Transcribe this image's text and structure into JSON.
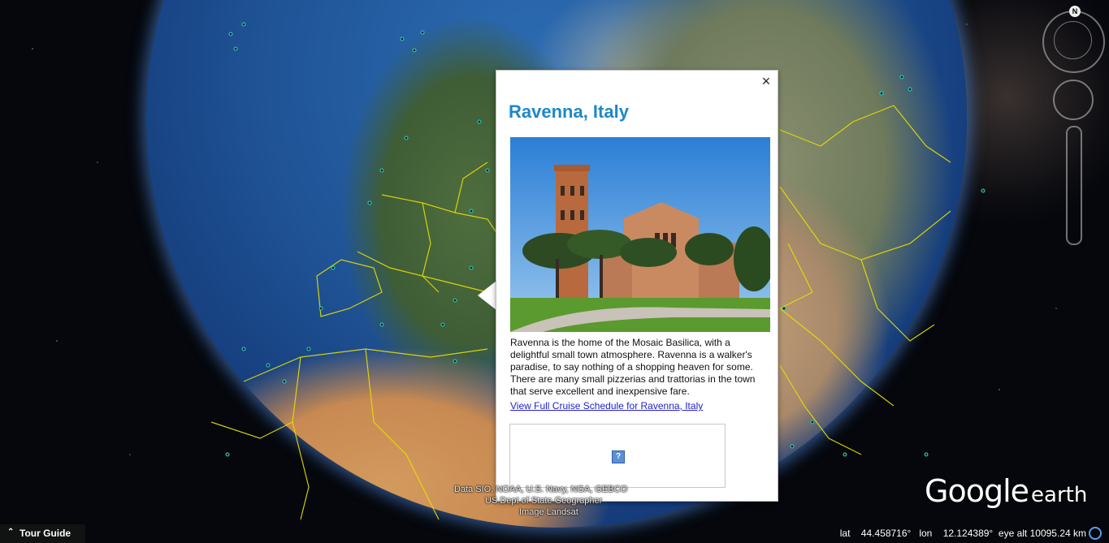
{
  "popup": {
    "title": "Ravenna, Italy",
    "close_icon": "×",
    "photo_alt": "Basilica of Sant'Apollinare in Classe with bell tower, Ravenna",
    "description": "Ravenna is the home of the Mosaic Basilica, with a delightful small town atmosphere. Ravenna is a walker's paradise, to say nothing of a shopping heaven for some. There are many small pizzerias and trattorias in the town that serve excellent and inexpensive fare.",
    "link_text": "View Full Cruise Schedule for Ravenna, Italy",
    "broken_icon": "?"
  },
  "nav": {
    "north_label": "N"
  },
  "logo": {
    "google": "Google",
    "earth": "earth"
  },
  "attribution": {
    "line1": "Data SIO, NOAA, U.S. Navy, NGA, GEBCO",
    "line2": "US Dept of State Geographer",
    "line3": "Image Landsat"
  },
  "tour_guide": {
    "label": "Tour Guide",
    "icon": "chevron-up-icon"
  },
  "status": {
    "lat_label": "lat",
    "lat_value": "44.458716°",
    "lon_label": "lon",
    "lon_value": "12.124389°",
    "eye_alt_label": "eye alt",
    "eye_alt_value": "10095.24 km"
  },
  "colors": {
    "title": "#1e88c8",
    "link": "#2222cc",
    "borders": "#e7e000"
  }
}
